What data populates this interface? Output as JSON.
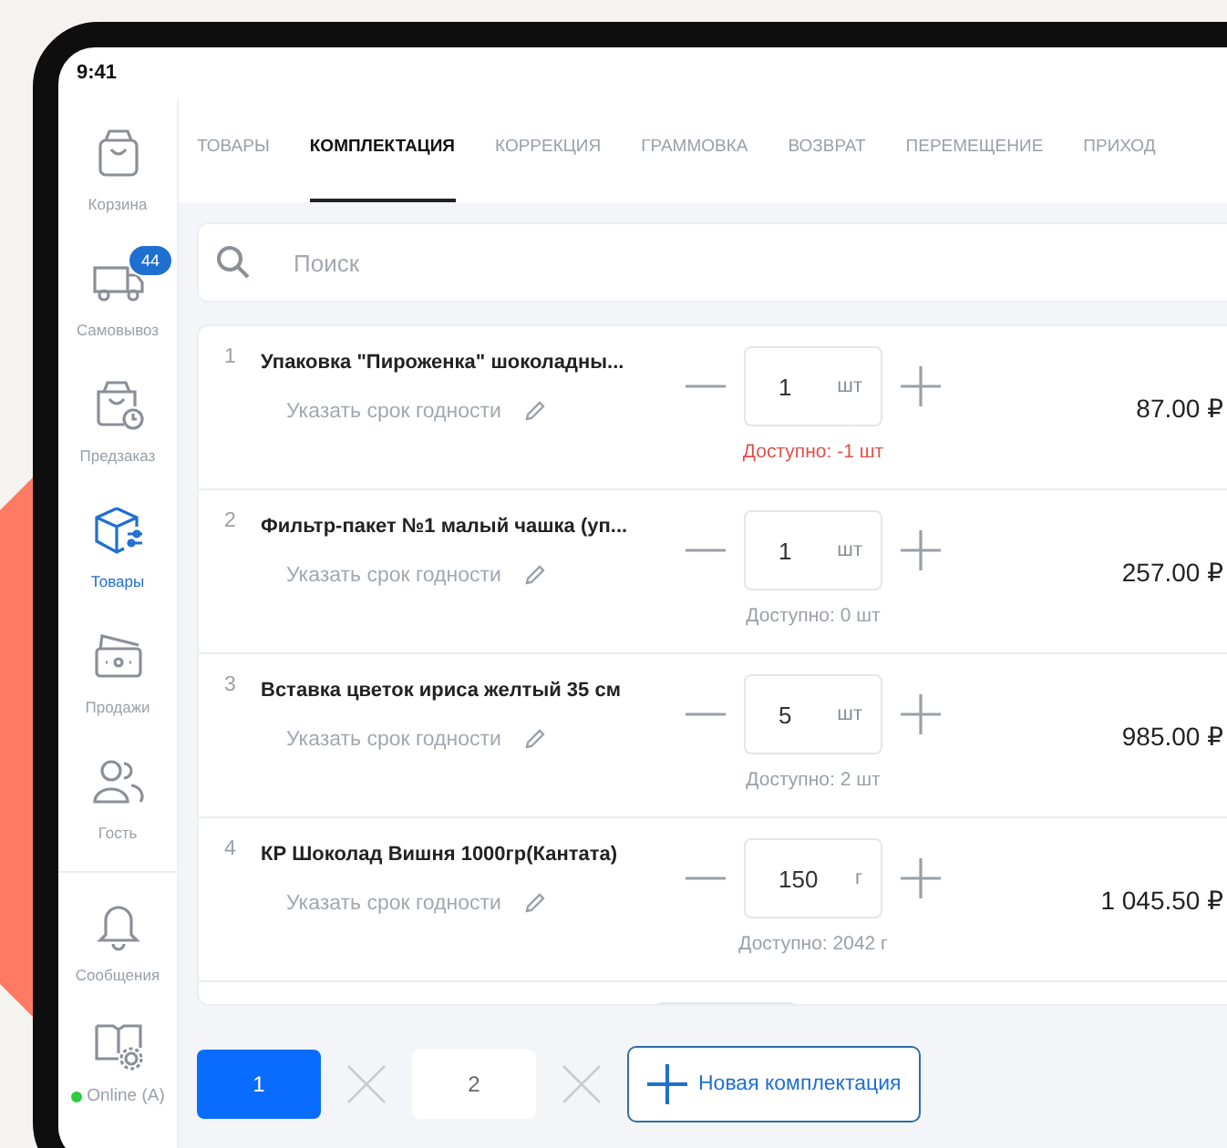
{
  "status_bar": {
    "time": "9:41"
  },
  "sidebar": {
    "items": [
      {
        "label": "Корзина",
        "kind": "bag",
        "selected": false
      },
      {
        "label": "Самовывоз",
        "kind": "truck",
        "selected": false,
        "badge": "44"
      },
      {
        "label": "Предзаказ",
        "kind": "bag-clock",
        "selected": false
      },
      {
        "label": "Товары",
        "kind": "box",
        "selected": true
      },
      {
        "label": "Продажи",
        "kind": "wallet",
        "selected": false
      },
      {
        "label": "Гость",
        "kind": "people",
        "selected": false
      }
    ],
    "footer_items": [
      {
        "label": "Сообщения",
        "kind": "bell"
      }
    ],
    "connection": {
      "label": "Online (A)",
      "online": true
    }
  },
  "tabs": [
    {
      "label": "ТОВАРЫ",
      "selected": false
    },
    {
      "label": "КОМПЛЕКТАЦИЯ",
      "selected": true
    },
    {
      "label": "КОРРЕКЦИЯ",
      "selected": false
    },
    {
      "label": "ГРАММОВКА",
      "selected": false
    },
    {
      "label": "ВОЗВРАТ",
      "selected": false
    },
    {
      "label": "ПЕРЕМЕЩЕНИЕ",
      "selected": false
    },
    {
      "label": "ПРИХОД",
      "selected": false
    }
  ],
  "search": {
    "placeholder": "Поиск"
  },
  "items": [
    {
      "index": "1",
      "name": "Упаковка \"Пироженка\" шоколадны...",
      "expiry_link": "Указать срок годности",
      "quantity": "1",
      "unit": "шт",
      "available": "Доступно: -1 шт",
      "shortage": true,
      "price": "87.00 ₽"
    },
    {
      "index": "2",
      "name": "Фильтр-пакет №1 малый чашка (уп...",
      "expiry_link": "Указать срок годности",
      "quantity": "1",
      "unit": "шт",
      "available": "Доступно: 0 шт",
      "shortage": false,
      "price": "257.00 ₽"
    },
    {
      "index": "3",
      "name": "Вставка цветок ириса желтый 35 см",
      "expiry_link": "Указать срок годности",
      "quantity": "5",
      "unit": "шт",
      "available": "Доступно: 2 шт",
      "shortage": false,
      "price": "985.00 ₽"
    },
    {
      "index": "4",
      "name": "КР Шоколад Вишня 1000гр(Кантата)",
      "expiry_link": "Указать срок годности",
      "quantity": "150",
      "unit": "г",
      "available": "Доступно: 2042 г",
      "shortage": false,
      "price": "1 045.50 ₽"
    }
  ],
  "bundles": [
    {
      "label": "1",
      "selected": true
    },
    {
      "label": "2",
      "selected": false
    }
  ],
  "new_bundle_button": "Новая комплектация"
}
